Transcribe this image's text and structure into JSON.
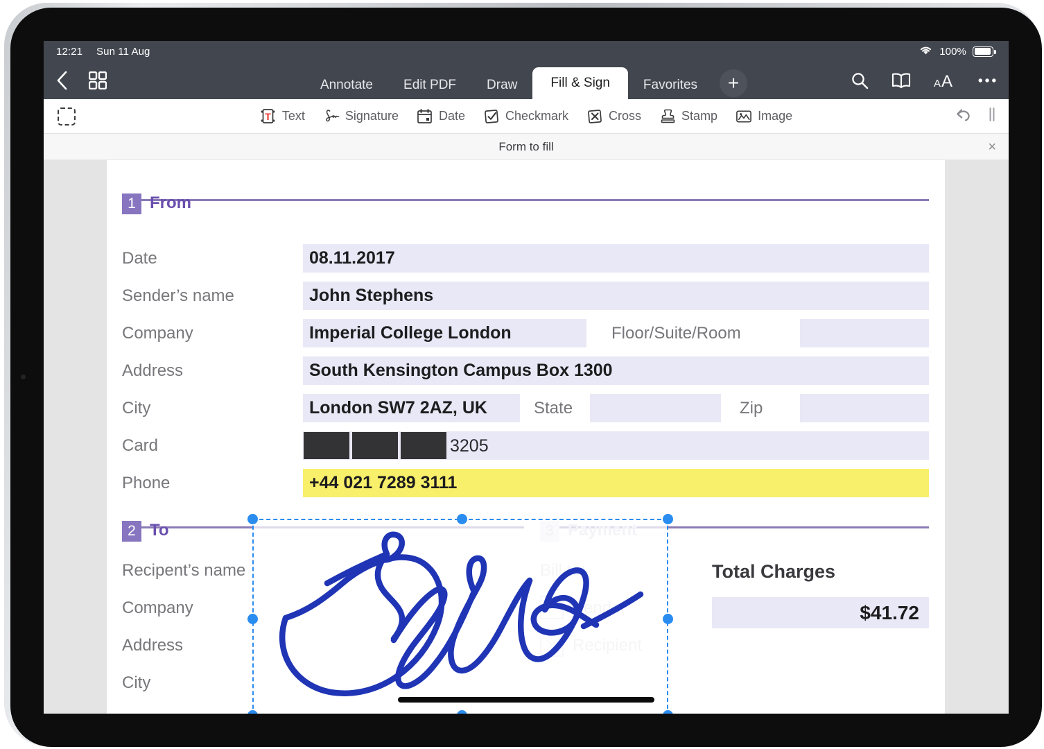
{
  "status_bar": {
    "time": "12:21",
    "date": "Sun 11 Aug",
    "battery_percent": "100%",
    "wifi_icon": "wifi-icon",
    "battery_icon": "battery-full-icon"
  },
  "nav_bar": {
    "back_icon": "chevron-left-icon",
    "grid_icon": "grid-thumbnails-icon",
    "tabs": [
      {
        "label": "Annotate",
        "active": false
      },
      {
        "label": "Edit PDF",
        "active": false
      },
      {
        "label": "Draw",
        "active": false
      },
      {
        "label": "Fill & Sign",
        "active": true
      },
      {
        "label": "Favorites",
        "active": false
      }
    ],
    "add_tab_label": "+",
    "right_icons": [
      {
        "name": "search-icon"
      },
      {
        "name": "book-reading-mode-icon"
      },
      {
        "name": "text-size-icon",
        "label": "aA"
      },
      {
        "name": "more-options-icon",
        "label": "•••"
      }
    ]
  },
  "tool_bar": {
    "select_icon": "marquee-select-icon",
    "items": [
      {
        "label": "Text",
        "icon": "text-tool-icon"
      },
      {
        "label": "Signature",
        "icon": "signature-tool-icon"
      },
      {
        "label": "Date",
        "icon": "date-tool-icon"
      },
      {
        "label": "Checkmark",
        "icon": "checkmark-tool-icon"
      },
      {
        "label": "Cross",
        "icon": "cross-tool-icon"
      },
      {
        "label": "Stamp",
        "icon": "stamp-tool-icon"
      },
      {
        "label": "Image",
        "icon": "image-tool-icon"
      }
    ],
    "undo_icon": "undo-icon",
    "pause_icon": "pause-bars-icon"
  },
  "banner": {
    "title": "Form to fill",
    "close_label": "×"
  },
  "form": {
    "accent_purple": "#6a4fae",
    "field_fill": "#e9e8f6",
    "highlight_yellow": "#f8ef6a",
    "sections": [
      {
        "number": "1",
        "title": "From"
      },
      {
        "number": "2",
        "title": "To"
      },
      {
        "number": "3",
        "title": "Payment"
      }
    ],
    "from": {
      "date_label": "Date",
      "date_value": "08.11.2017",
      "sender_label": "Sender’s name",
      "sender_value": "John Stephens",
      "company_label": "Company",
      "company_value": "Imperial College London",
      "floor_label": "Floor/Suite/Room",
      "floor_value": "",
      "address_label": "Address",
      "address_value": "South Kensington Campus Box 1300",
      "city_label": "City",
      "city_value": "London SW7 2AZ, UK",
      "state_label": "State",
      "state_value": "",
      "zip_label": "Zip",
      "zip_value": "",
      "card_label": "Card",
      "card_value": "3205",
      "card_redacted_blocks": 3,
      "phone_label": "Phone",
      "phone_value": "+44 021 7289 3111"
    },
    "to": {
      "recipient_label": "Recipent’s name",
      "company_label": "Company",
      "address_label": "Address",
      "city_label": "City"
    },
    "payment": {
      "bill_to_label": "Bill to:",
      "sender_option": "Sender",
      "sender_checked": false,
      "recipient_option": "Recipient",
      "recipient_checked": true,
      "total_label": "Total  Charges",
      "total_value": "$41.72"
    }
  },
  "selection": {
    "type": "signature-annotation",
    "handle_color": "#2b8cf0",
    "ink_color": "#1f35b5"
  }
}
